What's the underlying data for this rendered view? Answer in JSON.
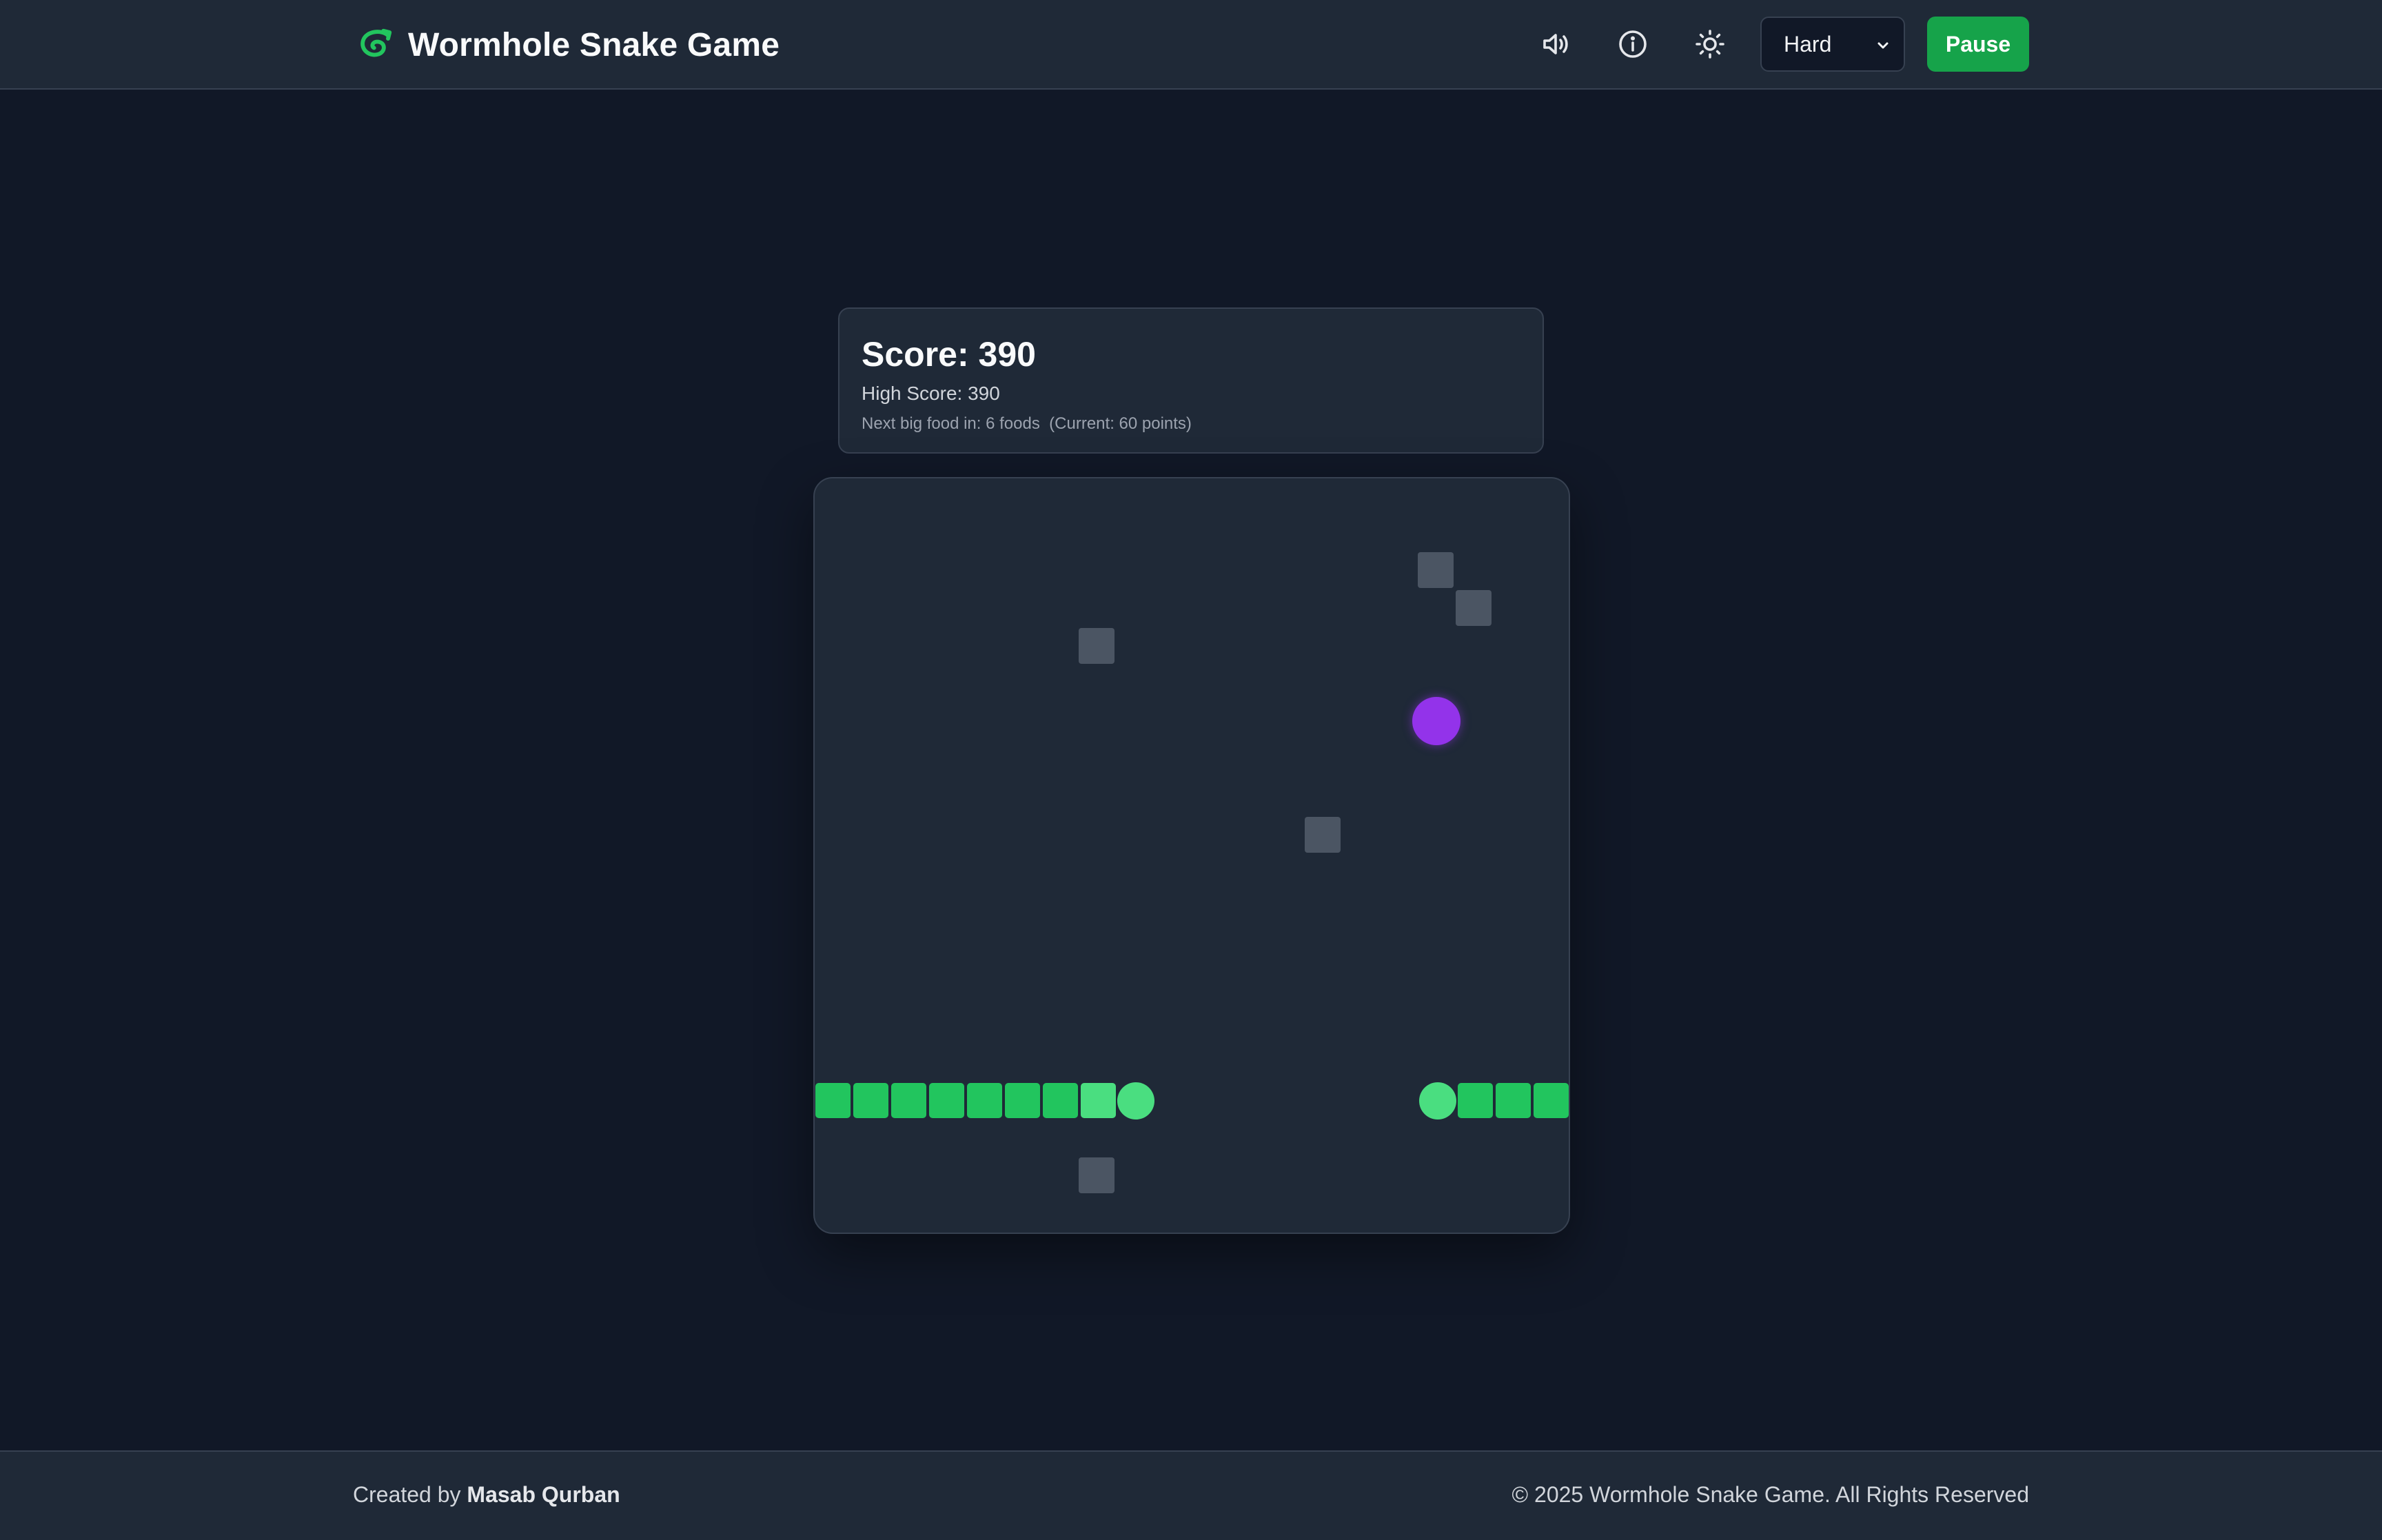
{
  "header": {
    "title": "Wormhole Snake Game",
    "logo_icon": "snake-swirl-icon",
    "icons": [
      "volume-icon",
      "info-icon",
      "sun-icon"
    ],
    "difficulty": {
      "selected": "Hard"
    },
    "pause_label": "Pause",
    "accent_color": "#16a34a"
  },
  "score_panel": {
    "score_text": "Score: 390",
    "high_score_text": "High Score: 390",
    "next_big_food_text": "Next big food in: 6 foods  (Current: 60 points)"
  },
  "board": {
    "background_color": "#1f2937",
    "snake_color": "#22c55e",
    "food_color": "#9333ea",
    "obstacle_color": "#4b5563"
  },
  "footer": {
    "credit_prefix": "Created by",
    "credit_author": "Masab Qurban",
    "copyright": "© 2025 Wormhole Snake Game. All Rights Reserved"
  }
}
